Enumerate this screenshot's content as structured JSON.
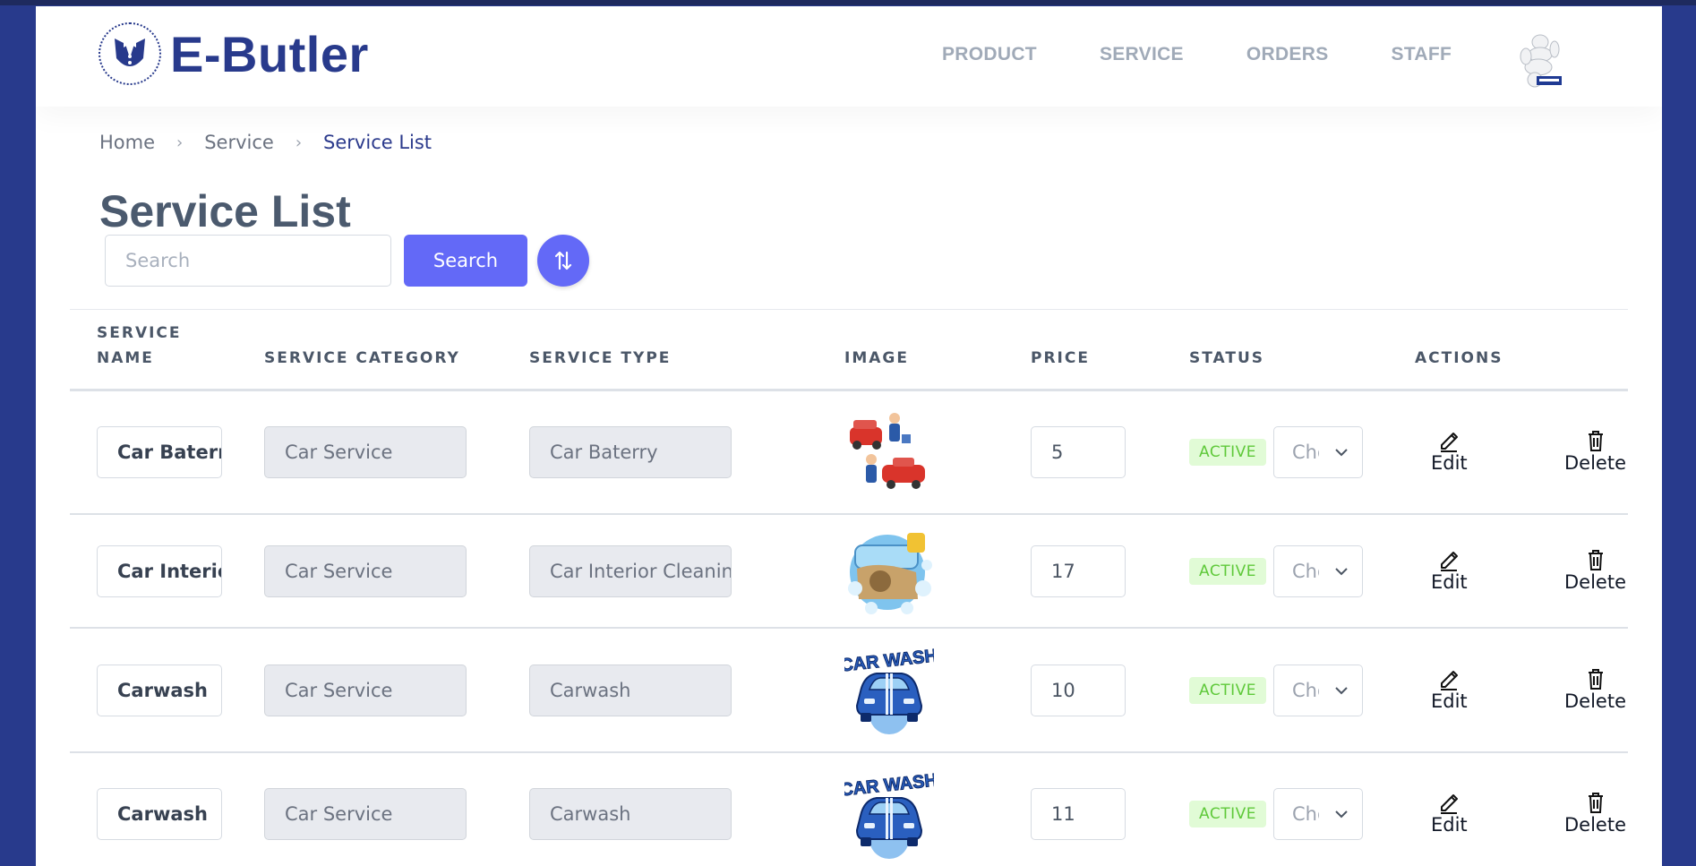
{
  "brand": {
    "name": "E-Butler",
    "color": "#283a8c"
  },
  "nav": {
    "items": [
      "PRODUCT",
      "SERVICE",
      "ORDERS",
      "STAFF"
    ]
  },
  "breadcrumb": {
    "items": [
      "Home",
      "Service",
      "Service List"
    ]
  },
  "page": {
    "title": "Service List"
  },
  "search": {
    "placeholder": "Search",
    "button_label": "Search"
  },
  "table": {
    "headers": {
      "name_line1": "SERVICE",
      "name_line2": "NAME",
      "category": "SERVICE CATEGORY",
      "type": "SERVICE TYPE",
      "image": "IMAGE",
      "price": "PRICE",
      "status": "STATUS",
      "actions": "ACTIONS"
    },
    "rows": [
      {
        "name": "Car Baterry",
        "category": "Car Service",
        "type": "Car Baterry",
        "image": "car-battery-service-illustration",
        "price": "5",
        "status": "ACTIVE",
        "status_select": "Choose",
        "edit": "Edit",
        "delete": "Delete"
      },
      {
        "name": "Car Interior Cleaning",
        "category": "Car Service",
        "type": "Car Interior Cleaning",
        "image": "car-interior-cleaning-illustration",
        "price": "17",
        "status": "ACTIVE",
        "status_select": "Choose",
        "edit": "Edit",
        "delete": "Delete"
      },
      {
        "name": "Carwash",
        "category": "Car Service",
        "type": "Carwash",
        "image": "car-wash-logo",
        "image_text": "CAR WASH",
        "price": "10",
        "status": "ACTIVE",
        "status_select": "Choose",
        "edit": "Edit",
        "delete": "Delete"
      },
      {
        "name": "Carwash",
        "category": "Car Service",
        "type": "Carwash",
        "image": "car-wash-logo",
        "image_text": "CAR WASH",
        "price": "11",
        "status": "ACTIVE",
        "status_select": "Choose",
        "edit": "Edit",
        "delete": "Delete"
      }
    ]
  },
  "colors": {
    "accent": "#6369f7",
    "active_badge_bg": "#e1fbd6",
    "active_badge_text": "#5fc93a",
    "page_bg": "#283a8c"
  },
  "icons": {
    "sort": "sort-arrows-icon",
    "edit": "pencil-icon",
    "delete": "trash-icon",
    "dropdown": "chevron-down-icon"
  }
}
